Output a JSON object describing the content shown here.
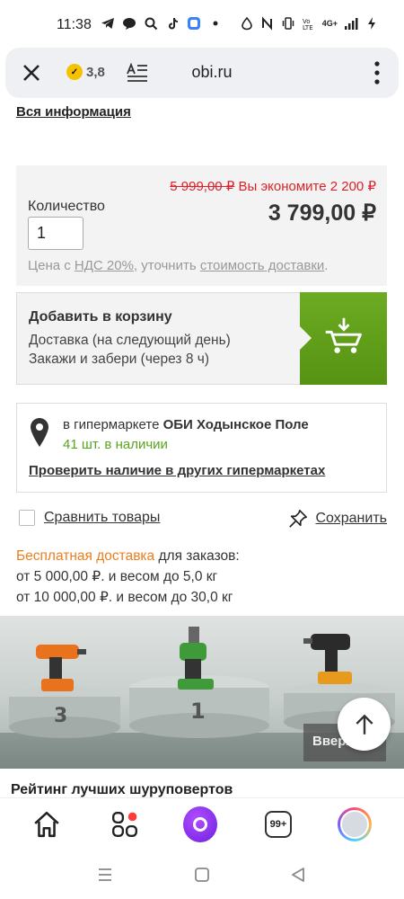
{
  "status": {
    "time": "11:38",
    "network": "4G+"
  },
  "browser": {
    "rating": "3,8",
    "domain": "obi.ru"
  },
  "product": {
    "all_info_link": "Вся информация",
    "old_price": "5 999,00 ₽",
    "savings": "Вы экономите 2 200 ₽",
    "quantity_label": "Количество",
    "quantity_value": "1",
    "price": "3 799,00 ₽",
    "vat_prefix": "Цена с ",
    "vat_link": "НДС 20%",
    "vat_middle": ", уточнить ",
    "delivery_cost_link": "стоимость доставки",
    "vat_suffix": "."
  },
  "cart": {
    "title": "Добавить в корзину",
    "line1": "Доставка (на следующий день)",
    "line2": "Закажи и забери (через 8 ч)"
  },
  "store": {
    "prefix": "в гипермаркете ",
    "name": "ОБИ Ходынское Поле",
    "stock": "41 шт. в наличии",
    "check_link": "Проверить наличие в других гипермаркетах"
  },
  "actions": {
    "compare": "Сравнить товары",
    "save": "Сохранить"
  },
  "delivery": {
    "free_label": "Бесплатная доставка",
    "free_suffix": " для заказов:",
    "line1": "от 5 000,00 ₽. и весом до 5,0 кг",
    "line2": "от 10 000,00 ₽. и весом до 30,0 кг"
  },
  "banner": {
    "title": "Рейтинг лучших шуруповертов",
    "scroll_label": "Вверх"
  },
  "bottom_bar": {
    "tabs_count": "99+"
  },
  "colors": {
    "accent_green": "#6cab22",
    "price_red": "#d9222a",
    "stock_green": "#5aa41b",
    "link_orange": "#ee7d1c"
  }
}
